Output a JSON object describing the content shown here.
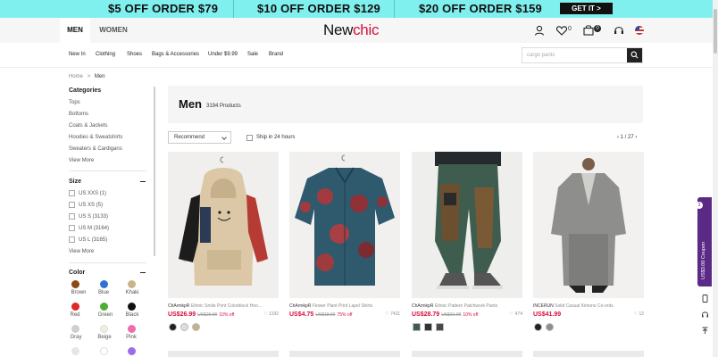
{
  "promo": {
    "offer1": "$5 OFF ORDER $79",
    "offer2": "$10 OFF ORDER $129",
    "offer3": "$20 OFF ORDER $159",
    "cta": "GET IT >"
  },
  "header": {
    "tab_men": "MEN",
    "tab_women": "WOMEN",
    "logo_new": "New",
    "logo_chic": "chic",
    "wishlist_count": "0",
    "cart_count": "0",
    "icons": [
      "user-icon",
      "heart-icon",
      "cart-icon",
      "headset-icon",
      "us-flag-icon"
    ]
  },
  "nav": {
    "items": [
      "New In",
      "Clothing",
      "Shoes",
      "Bags & Accessories",
      "Under $9.99",
      "Sale",
      "Brand"
    ],
    "search_placeholder": "cargo pants"
  },
  "breadcrumb": {
    "home": "Home",
    "sep": ">",
    "current": "Men"
  },
  "sidebar": {
    "categories_title": "Categories",
    "categories": [
      "Tops",
      "Bottoms",
      "Coats & Jackets",
      "Hoodies & Sweatshirts",
      "Sweaters & Cardigans"
    ],
    "categories_more": "View More",
    "size_title": "Size",
    "sizes": [
      "US XXS (1)",
      "US XS (5)",
      "US S (3133)",
      "US M (3164)",
      "US L (3165)"
    ],
    "size_more": "View More",
    "color_title": "Color",
    "colors": [
      {
        "name": "Brown",
        "hex": "#8b4a12"
      },
      {
        "name": "Blue",
        "hex": "#2f6fd6"
      },
      {
        "name": "Khaki",
        "hex": "#c9b48a"
      },
      {
        "name": "Red",
        "hex": "#e0262a"
      },
      {
        "name": "Green",
        "hex": "#4caf33"
      },
      {
        "name": "Black",
        "hex": "#111111"
      },
      {
        "name": "Gray",
        "hex": "#cfcfcf"
      },
      {
        "name": "Beige",
        "hex": "#f1ece0"
      },
      {
        "name": "Pink",
        "hex": "#f06bb0"
      }
    ]
  },
  "main": {
    "title": "Men",
    "count": "3194 Products",
    "sort": "Recommend",
    "ship_filter": "Ship in 24 hours",
    "pager": "1 / 27"
  },
  "products": [
    {
      "brand": "ChArmkpR",
      "title": "Ethnic Smile Print Colorblock Hoo...",
      "price": "US$26.99",
      "orig": "US$29.99",
      "off": "10% off",
      "likes": "1192"
    },
    {
      "brand": "ChArmkpR",
      "title": "Flower Plant Print Lapel Shirts",
      "price": "US$4.75",
      "orig": "US$18.99",
      "off": "75% off",
      "likes": "7411"
    },
    {
      "brand": "ChArmkpR",
      "title": "Ethnic Pattern Patchwork Pants",
      "price": "US$28.79",
      "orig": "US$31.99",
      "off": "10% off",
      "likes": "474"
    },
    {
      "brand": "INCERUN",
      "title": "Solid Casual Kimono Co-ords",
      "price": "US$41.99",
      "orig": "",
      "off": "",
      "likes": "12"
    }
  ],
  "coupon": {
    "label": "US$3.00 Coupon",
    "count": "3"
  },
  "accent": "#d6103c",
  "coupon_color": "#5b2a86"
}
